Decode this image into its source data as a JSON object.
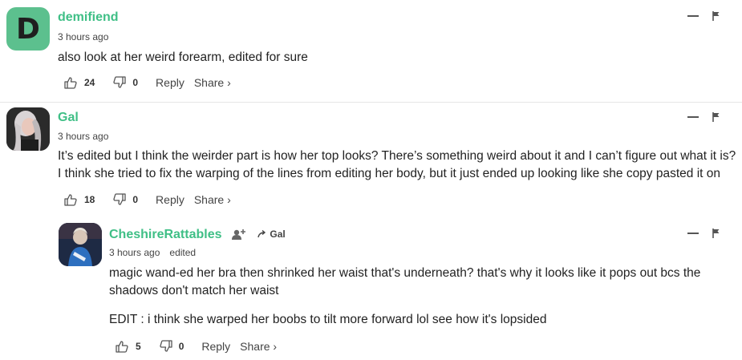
{
  "comments": [
    {
      "avatar_letter": "D",
      "username": "demifiend",
      "time": "3 hours ago",
      "text": [
        "also look at her weird forearm, edited for sure"
      ],
      "likes": "24",
      "dislikes": "0",
      "reply_label": "Reply",
      "share_label": "Share ›"
    },
    {
      "username": "Gal",
      "time": "3 hours ago",
      "text": [
        "It’s edited but I think the weirder part is how her top looks? There’s something weird about it and I can’t figure out what it is? I think she tried to fix the warping of the lines from editing her body, but it just ended up looking like she copy pasted it on"
      ],
      "likes": "18",
      "dislikes": "0",
      "reply_label": "Reply",
      "share_label": "Share ›"
    },
    {
      "username": "CheshireRattables",
      "reply_to": "Gal",
      "time": "3 hours ago",
      "edited": "edited",
      "text": [
        "magic wand-ed her bra then shrinked her waist that's underneath? that's why it looks like it pops out bcs the shadows don't match her waist",
        "EDIT : i think she warped her boobs to tilt more forward lol see how it's lopsided"
      ],
      "likes": "5",
      "dislikes": "0",
      "reply_label": "Reply",
      "share_label": "Share ›"
    }
  ],
  "colors": {
    "username": "#3fbf86",
    "avatar_bg": "#5cc08e"
  }
}
